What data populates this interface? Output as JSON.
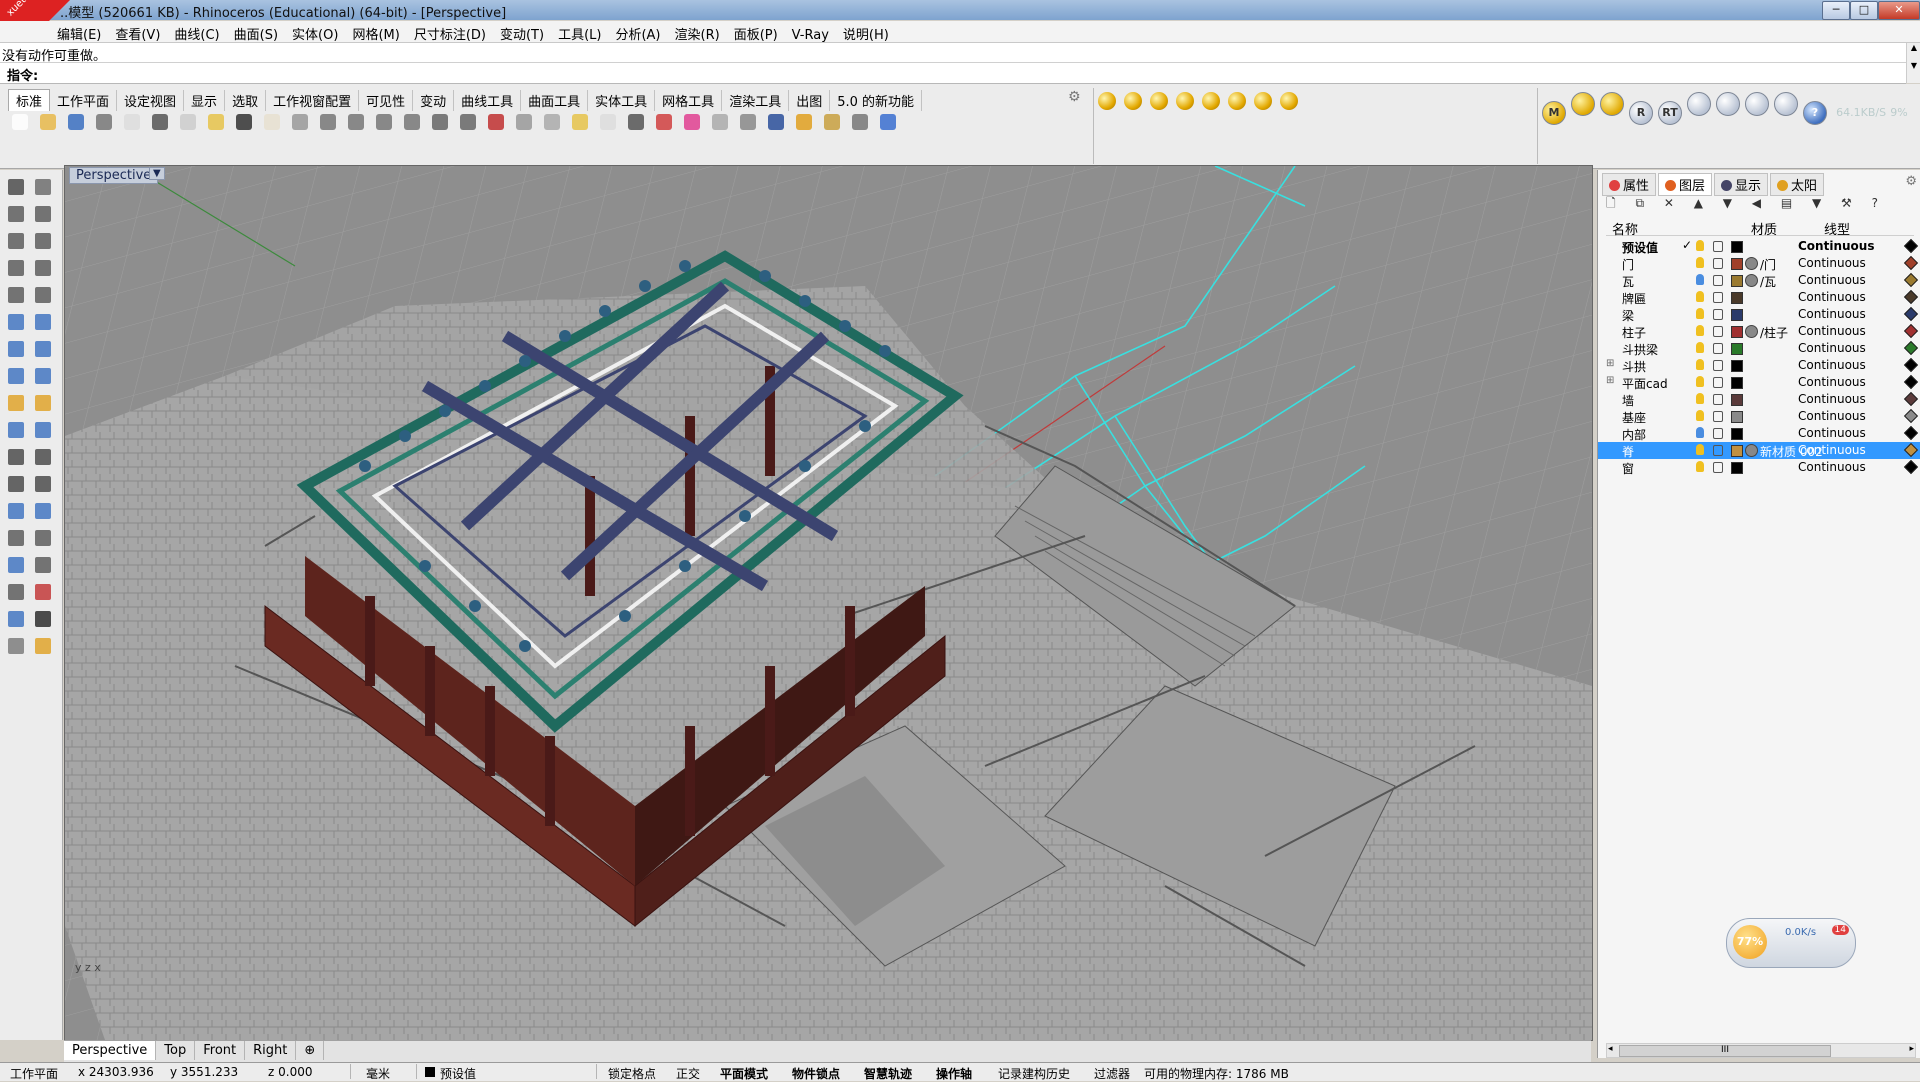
{
  "window": {
    "title": "..模型 (520661 KB) - Rhinoceros (Educational) (64-bit) - [Perspective]",
    "minimize": "─",
    "maximize": "□",
    "close": "✕",
    "corner_badge": "xuetiso 学习中心"
  },
  "menubar": [
    "编辑(E)",
    "查看(V)",
    "曲线(C)",
    "曲面(S)",
    "实体(O)",
    "网格(M)",
    "尺寸标注(D)",
    "变动(T)",
    "工具(L)",
    "分析(A)",
    "渲染(R)",
    "面板(P)",
    "V-Ray",
    "说明(H)"
  ],
  "command": {
    "history": "没有动作可重做。",
    "prompt": "指令:"
  },
  "toolbar_tabs": [
    "标准",
    "工作平面",
    "设定视图",
    "显示",
    "选取",
    "工作视窗配置",
    "可见性",
    "变动",
    "曲线工具",
    "曲面工具",
    "实体工具",
    "网格工具",
    "渲染工具",
    "出图",
    "5.0 的新功能"
  ],
  "toolbar_tools": [
    {
      "name": "new-icon",
      "color": "#ffffff"
    },
    {
      "name": "open-icon",
      "color": "#e8b84a"
    },
    {
      "name": "save-icon",
      "color": "#3a6fbf"
    },
    {
      "name": "print-icon",
      "color": "#777777"
    },
    {
      "name": "import-icon",
      "color": "#dddddd"
    },
    {
      "name": "cut-icon",
      "color": "#555555"
    },
    {
      "name": "copy-icon",
      "color": "#cccccc"
    },
    {
      "name": "paste-icon",
      "color": "#e6c34a"
    },
    {
      "name": "undo-icon",
      "color": "#333333"
    },
    {
      "name": "pan-icon",
      "color": "#e8e0d0"
    },
    {
      "name": "rotate-view-icon",
      "color": "#999999"
    },
    {
      "name": "zoom-icon",
      "color": "#777777"
    },
    {
      "name": "zoom-window-icon",
      "color": "#777777"
    },
    {
      "name": "zoom-extents-icon",
      "color": "#777777"
    },
    {
      "name": "zoom-selected-icon",
      "color": "#777777"
    },
    {
      "name": "rotate-icon",
      "color": "#666666"
    },
    {
      "name": "four-viewports-icon",
      "color": "#666666"
    },
    {
      "name": "car-icon",
      "color": "#c03030"
    },
    {
      "name": "named-view-icon",
      "color": "#999999"
    },
    {
      "name": "cplane-icon",
      "color": "#aaaaaa"
    },
    {
      "name": "select-icon",
      "color": "#e6c34a"
    },
    {
      "name": "light-icon",
      "color": "#dddddd"
    },
    {
      "name": "lock-icon",
      "color": "#555555"
    },
    {
      "name": "layer-icon",
      "color": "#d04040"
    },
    {
      "name": "color-wheel-icon",
      "color": "#e04090"
    },
    {
      "name": "sphere-icon",
      "color": "#aaaaaa"
    },
    {
      "name": "shaded-sphere-icon",
      "color": "#888888"
    },
    {
      "name": "render-sphere-icon",
      "color": "#2a4f9a"
    },
    {
      "name": "shade-icon",
      "color": "#e0a020"
    },
    {
      "name": "options-icon",
      "color": "#c8a040"
    },
    {
      "name": "snap-icon",
      "color": "#777777"
    },
    {
      "name": "help-icon",
      "color": "#3a6fd0"
    }
  ],
  "sun_tools": [
    "sun-icon",
    "sun-light-icon",
    "sphere-light-icon",
    "spot-light-icon",
    "area-light-icon",
    "directional-light-icon",
    "linear-light-icon",
    "arrow-light-icon"
  ],
  "vray_tools": [
    "M",
    "",
    "",
    "R",
    "RT",
    "",
    "",
    "",
    "",
    "?"
  ],
  "vray_status": "64.1KB/S",
  "vray_pct": "9%",
  "left_toolbar": [
    {
      "name": "select-arrow-icon",
      "color": "#444444"
    },
    {
      "name": "point-icon",
      "color": "#666666"
    },
    {
      "name": "polyline-icon",
      "color": "#555555"
    },
    {
      "name": "curve-icon",
      "color": "#555555"
    },
    {
      "name": "circle-icon",
      "color": "#555555"
    },
    {
      "name": "ellipse-icon",
      "color": "#555555"
    },
    {
      "name": "arc-icon",
      "color": "#555555"
    },
    {
      "name": "rectangle-icon",
      "color": "#555555"
    },
    {
      "name": "polygon-icon",
      "color": "#555555"
    },
    {
      "name": "curve-tools-icon",
      "color": "#555555"
    },
    {
      "name": "surface-icon",
      "color": "#3a6fbf"
    },
    {
      "name": "surface-tools-icon",
      "color": "#3a6fbf"
    },
    {
      "name": "box-icon",
      "color": "#3a6fbf"
    },
    {
      "name": "solid-tools-icon",
      "color": "#3a6fbf"
    },
    {
      "name": "mesh-icon",
      "color": "#3a6fbf"
    },
    {
      "name": "mesh-tools-icon",
      "color": "#3a6fbf"
    },
    {
      "name": "render-icon",
      "color": "#e0a020"
    },
    {
      "name": "explode-icon",
      "color": "#e0a020"
    },
    {
      "name": "trim-icon",
      "color": "#3a6fbf"
    },
    {
      "name": "split-icon",
      "color": "#3a6fbf"
    },
    {
      "name": "group-icon",
      "color": "#444444"
    },
    {
      "name": "ungroup-icon",
      "color": "#444444"
    },
    {
      "name": "fillet-icon",
      "color": "#444444"
    },
    {
      "name": "chamfer-icon",
      "color": "#444444"
    },
    {
      "name": "text-icon",
      "color": "#3a6fbf"
    },
    {
      "name": "move-icon",
      "color": "#3a6fbf"
    },
    {
      "name": "copy-move-icon",
      "color": "#555555"
    },
    {
      "name": "rotate-tool-icon",
      "color": "#555555"
    },
    {
      "name": "boolean-icon",
      "color": "#3a6fbf"
    },
    {
      "name": "dimension-icon",
      "color": "#555555"
    },
    {
      "name": "array-icon",
      "color": "#555555"
    },
    {
      "name": "ruler-icon",
      "color": "#c03030"
    },
    {
      "name": "analyze-icon",
      "color": "#3a6fbf"
    },
    {
      "name": "check-icon",
      "color": "#222222"
    },
    {
      "name": "material-icon",
      "color": "#777777"
    },
    {
      "name": "paint-icon",
      "color": "#e0a020"
    }
  ],
  "viewport": {
    "label": "Perspective",
    "tabs": [
      "Perspective",
      "Top",
      "Front",
      "Right",
      "⊕"
    ]
  },
  "panel": {
    "tabs": [
      {
        "label": "属性",
        "color": "#e04040"
      },
      {
        "label": "图层",
        "color": "#e06020"
      },
      {
        "label": "显示",
        "color": "#446"
      },
      {
        "label": "太阳",
        "color": "#e0a020"
      }
    ],
    "tools": "🗋 ⧉ ✕ ▲ ▼ ◀ ▤ ▼ ⚒ ?",
    "columns": {
      "name": "名称",
      "material": "材质",
      "linetype": "线型"
    },
    "layers": [
      {
        "name": "预设值",
        "check": "✓",
        "swatch": "#000000",
        "material": "",
        "linetype": "Continuous",
        "bold": true,
        "bulb_blue": false,
        "expand": "",
        "selected": false
      },
      {
        "name": "门",
        "check": "",
        "swatch": "#a0402a",
        "material": "/门",
        "linetype": "Continuous",
        "bold": false,
        "bulb_blue": false,
        "expand": "",
        "selected": false
      },
      {
        "name": "瓦",
        "check": "",
        "swatch": "#9a7a30",
        "material": "/瓦",
        "linetype": "Continuous",
        "bold": false,
        "bulb_blue": true,
        "expand": "",
        "selected": false
      },
      {
        "name": "牌匾",
        "check": "",
        "swatch": "#4a3a2a",
        "material": "",
        "linetype": "Continuous",
        "bold": false,
        "bulb_blue": false,
        "expand": "",
        "selected": false
      },
      {
        "name": "梁",
        "check": "",
        "swatch": "#2a3a6a",
        "material": "",
        "linetype": "Continuous",
        "bold": false,
        "bulb_blue": false,
        "expand": "",
        "selected": false
      },
      {
        "name": "柱子",
        "check": "",
        "swatch": "#a03030",
        "material": "/柱子",
        "linetype": "Continuous",
        "bold": false,
        "bulb_blue": false,
        "expand": "",
        "selected": false
      },
      {
        "name": "斗拱梁",
        "check": "",
        "swatch": "#2a7a2a",
        "material": "",
        "linetype": "Continuous",
        "bold": false,
        "bulb_blue": false,
        "expand": "",
        "selected": false
      },
      {
        "name": "斗拱",
        "check": "",
        "swatch": "#000000",
        "material": "",
        "linetype": "Continuous",
        "bold": false,
        "bulb_blue": false,
        "expand": "⊞",
        "selected": false
      },
      {
        "name": "平面cad",
        "check": "",
        "swatch": "#000000",
        "material": "",
        "linetype": "Continuous",
        "bold": false,
        "bulb_blue": false,
        "expand": "⊞",
        "selected": false
      },
      {
        "name": "墙",
        "check": "",
        "swatch": "#5a3a3a",
        "material": "",
        "linetype": "Continuous",
        "bold": false,
        "bulb_blue": false,
        "expand": "",
        "selected": false
      },
      {
        "name": "基座",
        "check": "",
        "swatch": "#8a8a8a",
        "material": "",
        "linetype": "Continuous",
        "bold": false,
        "bulb_blue": false,
        "expand": "",
        "selected": false
      },
      {
        "name": "内部",
        "check": "",
        "swatch": "#000000",
        "material": "",
        "linetype": "Continuous",
        "bold": false,
        "bulb_blue": true,
        "expand": "",
        "selected": false
      },
      {
        "name": "脊",
        "check": "",
        "swatch": "#c09040",
        "material": "新材质 002",
        "linetype": "Continuous",
        "bold": false,
        "bulb_blue": false,
        "expand": "",
        "selected": true
      },
      {
        "name": "窗",
        "check": "",
        "swatch": "#000000",
        "material": "",
        "linetype": "Continuous",
        "bold": false,
        "bulb_blue": false,
        "expand": "",
        "selected": false
      }
    ],
    "hscroll_thumb": "III",
    "hscroll_left": "◂",
    "hscroll_right": "▸"
  },
  "widget": {
    "percent": "77%",
    "speed": "0.0K/s",
    "badge": "14"
  },
  "status": {
    "cplane": "工作平面",
    "x": "x 24303.936",
    "y": "y 3551.233",
    "z": "z 0.000",
    "units": "毫米",
    "layer": "预设值",
    "snap": "锁定格点",
    "ortho": "正交",
    "planar": "平面模式",
    "osnap": "物件锁点",
    "smarttrack": "智慧轨迹",
    "gumball": "操作轴",
    "history": "记录建构历史",
    "filter": "过滤器",
    "memory": "可用的物理内存: 1786 MB"
  },
  "colors": {
    "grid": "#9a9a9a",
    "cad_lines": "#38e0e0",
    "roof_green": "#1f6a5e",
    "wall_red": "#6a2a22",
    "stone": "#a4a4a4",
    "beam": "#3c4470"
  }
}
